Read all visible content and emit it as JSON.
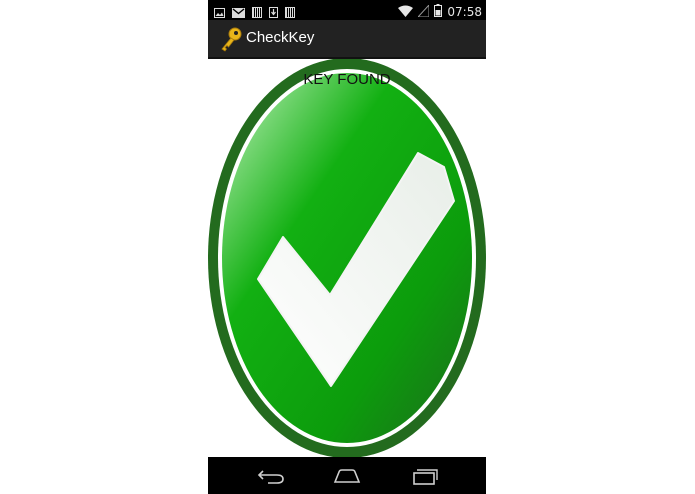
{
  "status_bar": {
    "time": "07:58",
    "icons_left": [
      "image-icon",
      "gmail-icon",
      "barcode-icon",
      "download-icon",
      "barcode-icon"
    ],
    "icons_right": [
      "wifi-icon",
      "no-signal-icon",
      "battery-icon"
    ]
  },
  "action_bar": {
    "title": "CheckKey",
    "icon": "key-icon"
  },
  "main": {
    "result_text": "KEY FOUND",
    "image": "green-checkmark-icon"
  },
  "nav_bar": {
    "buttons": [
      "back-icon",
      "home-icon",
      "recent-apps-icon"
    ]
  },
  "colors": {
    "status_bar": "#000000",
    "action_bar": "#222222",
    "check_green": "#11a611",
    "check_dark": "#1d6b1d",
    "nav_bar": "#000000"
  }
}
